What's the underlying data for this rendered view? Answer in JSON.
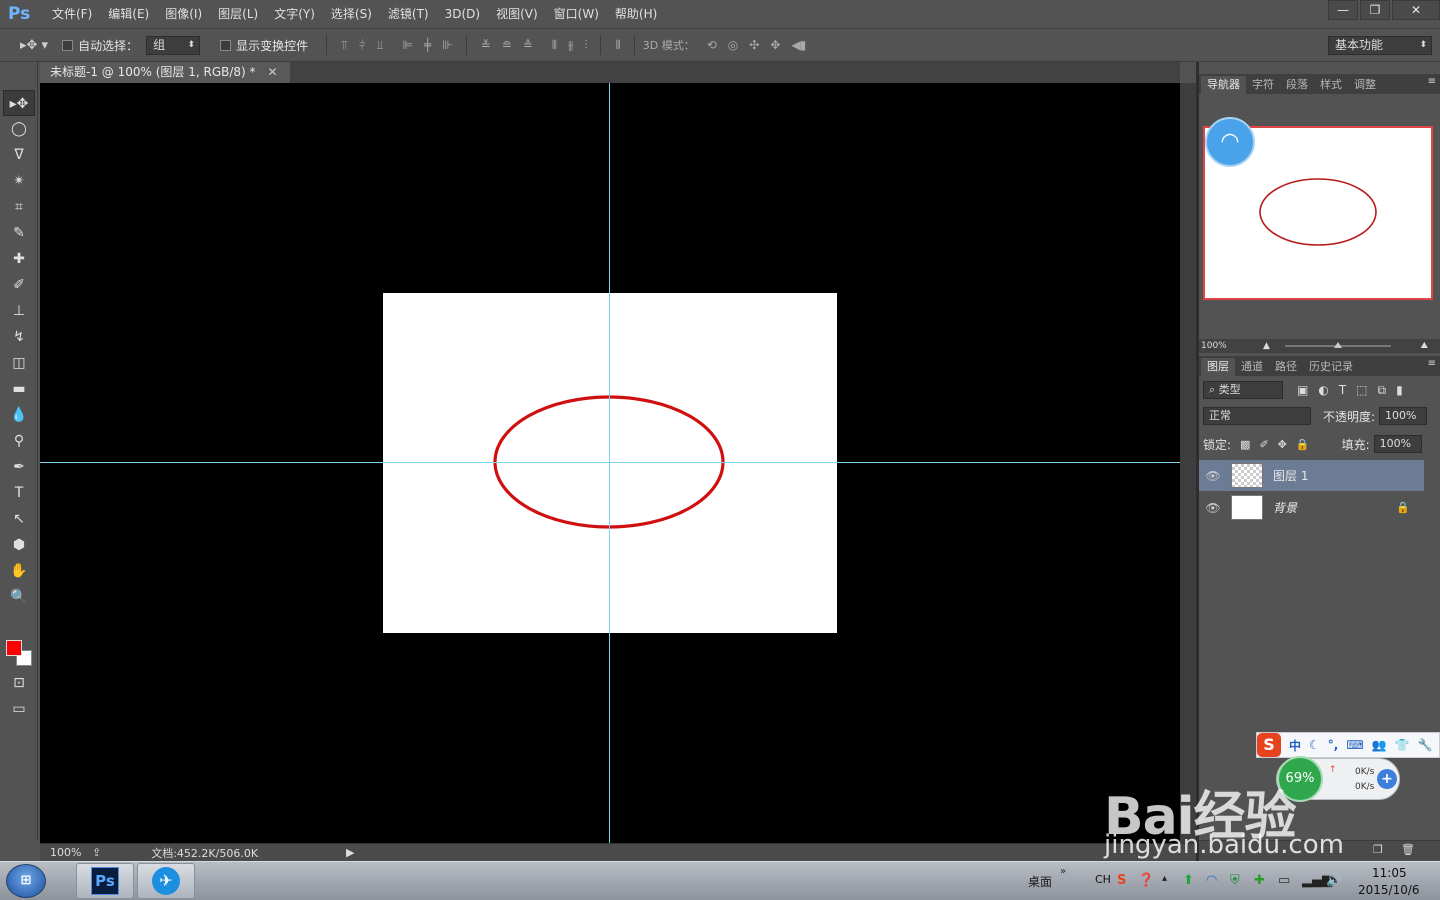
{
  "app": {
    "logo": "Ps"
  },
  "menu": [
    "文件(F)",
    "编辑(E)",
    "图像(I)",
    "图层(L)",
    "文字(Y)",
    "选择(S)",
    "滤镜(T)",
    "3D(D)",
    "视图(V)",
    "窗口(W)",
    "帮助(H)"
  ],
  "window_controls": {
    "minimize": "—",
    "restore": "❐",
    "close": "✕"
  },
  "options": {
    "auto_select_label": "自动选择：",
    "auto_select_value": "组",
    "show_transform_label": "显示变换控件",
    "mode_3d_label": "3D 模式：",
    "workspace": "基本功能"
  },
  "document": {
    "tab_title": "未标题-1 @ 100% (图层 1, RGB/8) *",
    "tab_close": "✕"
  },
  "status": {
    "zoom": "100%",
    "doc_size": "文档:452.2K/506.0K"
  },
  "colors": {
    "foreground": "#ff0000",
    "background": "#ffffff",
    "guide": "#7fd4ee",
    "ellipse": "#d01010"
  },
  "navigator": {
    "tabs": [
      "导航器",
      "字符",
      "段落",
      "样式",
      "调整"
    ],
    "zoom": "100%"
  },
  "layers_panel": {
    "tabs": [
      "图层",
      "通道",
      "路径",
      "历史记录"
    ],
    "filter_kind": "类型",
    "blend_mode": "正常",
    "opacity_label": "不透明度:",
    "opacity_value": "100%",
    "lock_label": "锁定:",
    "fill_label": "填充:",
    "fill_value": "100%",
    "layers": [
      {
        "name": "图层 1",
        "selected": true,
        "visible": true
      },
      {
        "name": "背景",
        "selected": false,
        "visible": true,
        "locked": true
      }
    ]
  },
  "sogou": {
    "logo": "S",
    "mode": "中"
  },
  "speed_widget": {
    "percent": "69%",
    "up": "0K/s",
    "down": "0K/s"
  },
  "watermark": {
    "brand": "Bai经验",
    "url": "jingyan.baidu.com"
  },
  "taskbar": {
    "ps_icon": "Ps",
    "desktop_label": "桌面",
    "lang": "CH",
    "time": "11:05",
    "date": "2015/10/6"
  }
}
